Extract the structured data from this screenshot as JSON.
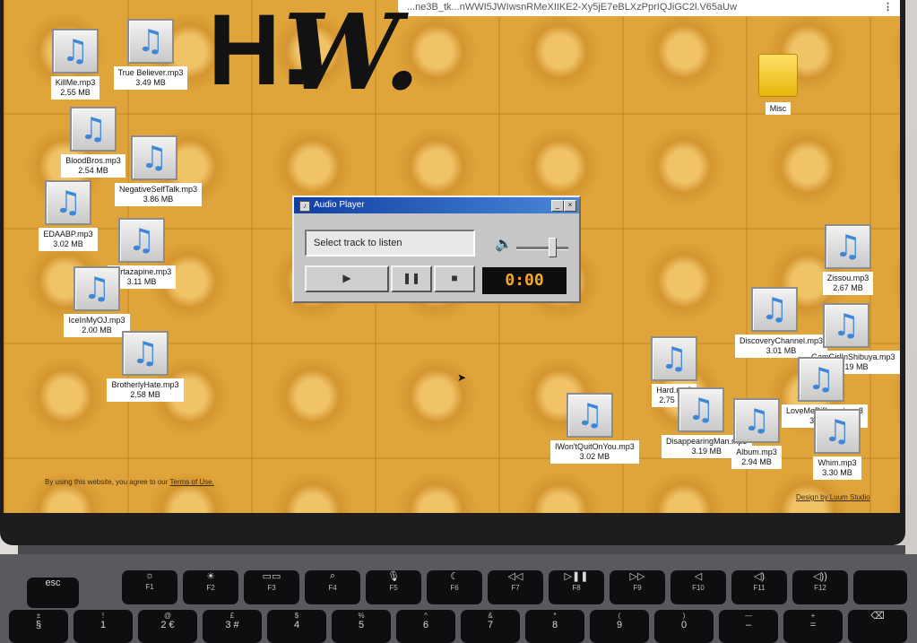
{
  "browser": {
    "url": "...ne3B_tk...nWWI5JWIwsnRMeXIIKE2-Xy5jE7eBLXzPprIQJiGC2l.V65aUw",
    "menu_icon": "kebab-icon"
  },
  "logo": {
    "letters": "H.",
    "script": "W."
  },
  "desktop_icons": [
    {
      "name": "KillMe.mp3",
      "size": "2.55 MB"
    },
    {
      "name": "True Believer.mp3",
      "size": "3.49 MB"
    },
    {
      "name": "BloodBros.mp3",
      "size": "2.54 MB"
    },
    {
      "name": "NegativeSelfTalk.mp3",
      "size": "3.86 MB"
    },
    {
      "name": "EDAABP.mp3",
      "size": "3.02 MB"
    },
    {
      "name": "Mirtazapine.mp3",
      "size": "3.11 MB"
    },
    {
      "name": "IceInMyOJ.mp3",
      "size": "2.00 MB"
    },
    {
      "name": "BrotherlyHate.mp3",
      "size": "2.58 MB"
    },
    {
      "name": "Zissou.mp3",
      "size": "2.67 MB"
    },
    {
      "name": "DiscoveryChannel.mp3",
      "size": "3.01 MB"
    },
    {
      "name": "GamGirlInShibuya.mp3",
      "size": "3.19 MB"
    },
    {
      "name": "Hard.mp3",
      "size": "2.75 MB"
    },
    {
      "name": "LoveMeDifferent.mp3",
      "size": "3.22 MB"
    },
    {
      "name": "IWon'tQuitOnYou.mp3",
      "size": "3.02 MB"
    },
    {
      "name": "DisappearingMan.mp3",
      "size": "3.19 MB"
    },
    {
      "name": "Album.mp3",
      "size": "2.94 MB"
    },
    {
      "name": "Whim.mp3",
      "size": "3.30 MB"
    }
  ],
  "folder": {
    "name": "Misc",
    "icon": "folder-icon"
  },
  "player": {
    "title": "Audio Player",
    "minimize_label": "_",
    "close_label": "×",
    "track_placeholder": "Select track to listen",
    "play_label": "▶",
    "pause_label": "❚❚",
    "stop_label": "■",
    "time": "0:00",
    "volume_icon": "speaker-icon"
  },
  "footer": {
    "terms_text": "By using this website, you agree to our",
    "terms_link": "Terms of Use.",
    "credit": "Design by Luum Studio"
  },
  "keyboard": {
    "fn_row": [
      {
        "label": "esc",
        "sub": ""
      },
      {
        "label": "☼",
        "sub": "F1"
      },
      {
        "label": "☀",
        "sub": "F2"
      },
      {
        "label": "▭▭",
        "sub": "F3"
      },
      {
        "label": "⌕",
        "sub": "F4"
      },
      {
        "label": "🎙",
        "sub": "F5"
      },
      {
        "label": "☾",
        "sub": "F6"
      },
      {
        "label": "◁◁",
        "sub": "F7"
      },
      {
        "label": "▷❚❚",
        "sub": "F8"
      },
      {
        "label": "▷▷",
        "sub": "F9"
      },
      {
        "label": "◁",
        "sub": "F10"
      },
      {
        "label": "◁)",
        "sub": "F11"
      },
      {
        "label": "◁))",
        "sub": "F12"
      },
      {
        "label": "",
        "sub": ""
      }
    ],
    "num_row": [
      {
        "label": "§",
        "sub": "±"
      },
      {
        "label": "1",
        "sub": "!"
      },
      {
        "label": "2 €",
        "sub": "@"
      },
      {
        "label": "3 #",
        "sub": "£"
      },
      {
        "label": "4",
        "sub": "$"
      },
      {
        "label": "5",
        "sub": "%"
      },
      {
        "label": "6",
        "sub": "^"
      },
      {
        "label": "7",
        "sub": "&"
      },
      {
        "label": "8",
        "sub": "*"
      },
      {
        "label": "9",
        "sub": "("
      },
      {
        "label": "0",
        "sub": ")"
      },
      {
        "label": "–",
        "sub": "—"
      },
      {
        "label": "=",
        "sub": "+"
      },
      {
        "label": "⌫",
        "sub": ""
      }
    ]
  }
}
